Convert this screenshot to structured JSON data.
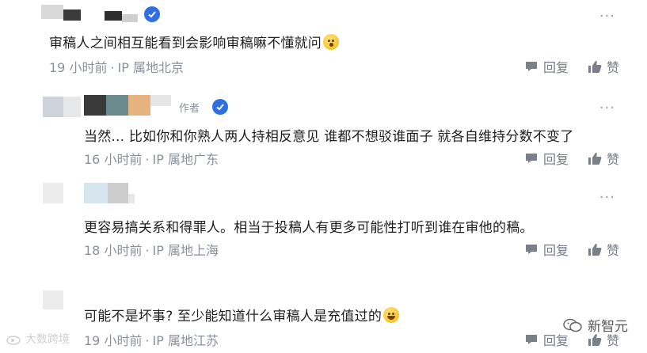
{
  "comments": [
    {
      "text": "审稿人之间相互能看到会影响审稿嘛不懂就问",
      "emoji": "face-with-open-mouth",
      "time": "19 小时前",
      "ip": "IP 属地北京",
      "reply_label": "回复",
      "like_label": "赞",
      "verified": true
    },
    {
      "author_tag": "作者",
      "text": "当然... 比如你和你熟人两人持相反意见 谁都不想驳谁面子 就各自维持分数不变了",
      "time": "16 小时前",
      "ip": "IP 属地广东",
      "reply_label": "回复",
      "like_label": "赞",
      "verified": true
    },
    {
      "text": "更容易搞关系和得罪人。相当于投稿人有更多可能性打听到谁在审他的稿。",
      "time": "18 小时前",
      "ip": "IP 属地上海",
      "reply_label": "回复",
      "like_label": "赞"
    },
    {
      "text": "可能不是坏事? 至少能知道什么审稿人是充值过的",
      "emoji": "grinning-face",
      "time": "19 小时前",
      "ip": "IP 属地江苏",
      "reply_label": "回复",
      "like_label": "赞"
    }
  ],
  "more_label": "···",
  "separator": "·",
  "watermark_left": "大数跨境",
  "watermark_right": "新智元",
  "colors": {
    "verified_blue": "#2f6fe0",
    "meta_gray": "#8a8f99",
    "text_dark": "#1f1f1f"
  }
}
